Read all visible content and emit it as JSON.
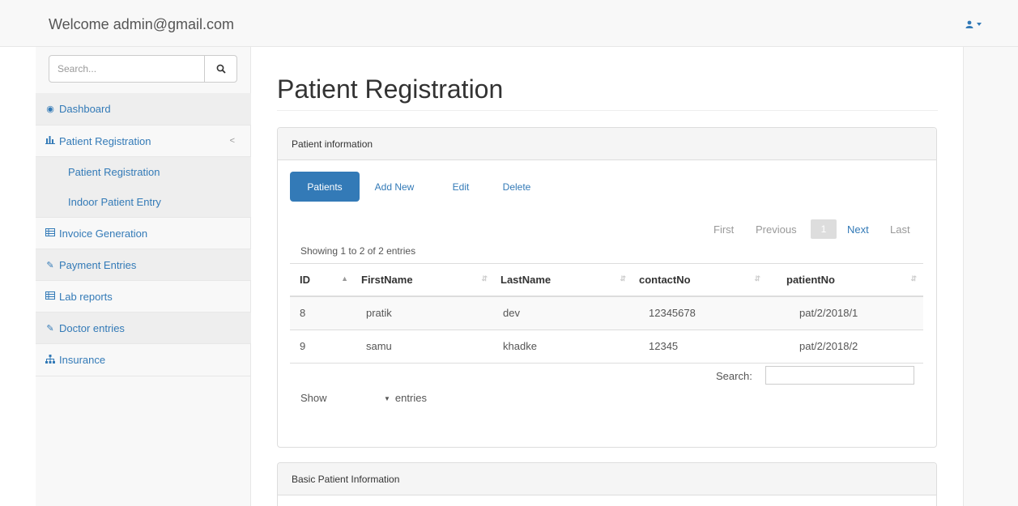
{
  "header": {
    "welcome": "Welcome admin@gmail.com",
    "user_icon": "user-icon"
  },
  "sidebar": {
    "search_placeholder": "Search...",
    "items": [
      {
        "label": "Dashboard",
        "icon": "dashboard-icon"
      },
      {
        "label": "Patient Registration",
        "icon": "bar-chart-icon"
      },
      {
        "label": "Patient Registration"
      },
      {
        "label": "Indoor Patient Entry"
      },
      {
        "label": "Invoice Generation",
        "icon": "table-icon"
      },
      {
        "label": "Payment Entries",
        "icon": "edit-icon"
      },
      {
        "label": "Lab reports",
        "icon": "table-icon"
      },
      {
        "label": "Doctor entries",
        "icon": "edit-icon"
      },
      {
        "label": "Insurance",
        "icon": "sitemap-icon"
      }
    ],
    "chevron": "<"
  },
  "page": {
    "title": "Patient Registration"
  },
  "panel": {
    "heading": "Patient information",
    "tabs": [
      "Patients",
      "Add New",
      "Edit",
      "Delete"
    ],
    "active_tab": "Patients"
  },
  "pagination": {
    "first": "First",
    "previous": "Previous",
    "current": "1",
    "next": "Next",
    "last": "Last"
  },
  "table": {
    "info": "Showing 1 to 2 of 2 entries",
    "columns": [
      "ID",
      "FirstName",
      "LastName",
      "contactNo",
      "patientNo"
    ],
    "rows": [
      [
        "8",
        "pratik",
        "dev",
        "12345678",
        "pat/2/2018/1"
      ],
      [
        "9",
        "samu",
        "khadke",
        "12345",
        "pat/2/2018/2"
      ]
    ],
    "search_label": "Search:",
    "show_label": "Show",
    "entries_label": "entries"
  },
  "panel2": {
    "heading": "Basic Patient Information"
  },
  "colors": {
    "accent": "#337ab7",
    "sidebar_bg": "#f8f8f8",
    "panel_heading_bg": "#f5f5f5"
  }
}
